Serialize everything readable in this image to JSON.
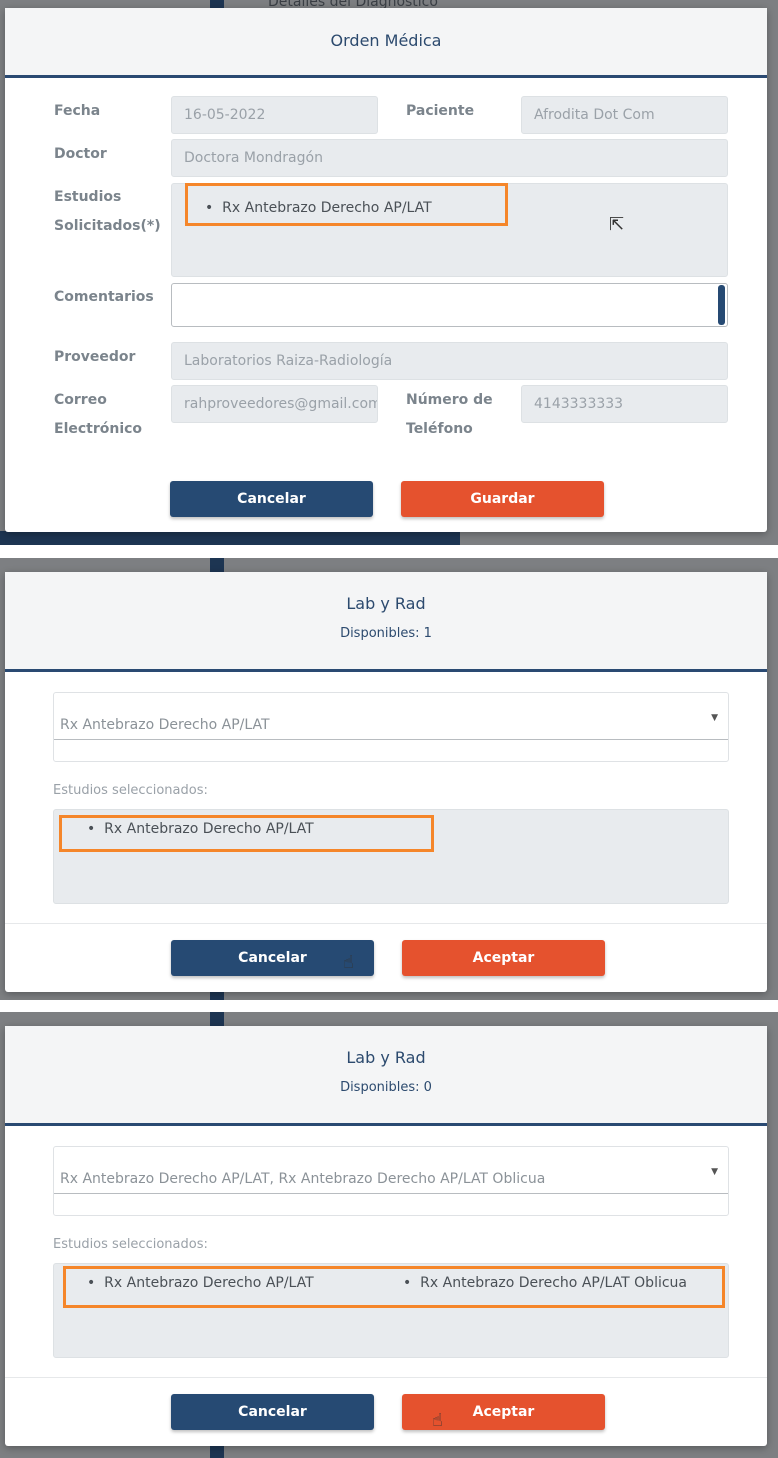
{
  "background": {
    "section_title": "Detalles del Diagnóstico"
  },
  "orden_medica": {
    "title": "Orden Médica",
    "fecha_label": "Fecha",
    "fecha": "16-05-2022",
    "paciente_label": "Paciente",
    "paciente": "Afrodita Dot Com",
    "doctor_label": "Doctor",
    "doctor": "Doctora Mondragón",
    "estudios_label_1": "Estudios",
    "estudios_label_2": "Solicitados(*)",
    "estudios": [
      "Rx Antebrazo Derecho AP/LAT"
    ],
    "comentarios_label": "Comentarios",
    "comentarios": "",
    "proveedor_label": "Proveedor",
    "proveedor": "Laboratorios Raiza-Radiología",
    "correo_label_1": "Correo",
    "correo_label_2": "Electrónico",
    "correo": "rahproveedores@gmail.com",
    "telefono_label_1": "Número de",
    "telefono_label_2": "Teléfono",
    "telefono": "4143333333",
    "cancel": "Cancelar",
    "save": "Guardar"
  },
  "lab_rad_1": {
    "title": "Lab y Rad",
    "available": "Disponibles: 1",
    "select_value": "Rx Antebrazo Derecho AP/LAT",
    "selected_label": "Estudios seleccionados:",
    "selected": [
      "Rx Antebrazo Derecho AP/LAT"
    ],
    "cancel": "Cancelar",
    "accept": "Aceptar"
  },
  "lab_rad_2": {
    "title": "Lab y Rad",
    "available": "Disponibles: 0",
    "select_value": "Rx Antebrazo Derecho AP/LAT, Rx Antebrazo Derecho AP/LAT Oblicua",
    "selected_label": "Estudios seleccionados:",
    "selected": [
      "Rx Antebrazo Derecho AP/LAT",
      "Rx Antebrazo Derecho AP/LAT Oblicua"
    ],
    "cancel": "Cancelar",
    "accept": "Aceptar"
  },
  "colors": {
    "navy": "#264a73",
    "orange": "#e5522e",
    "highlight": "#f5862a"
  }
}
